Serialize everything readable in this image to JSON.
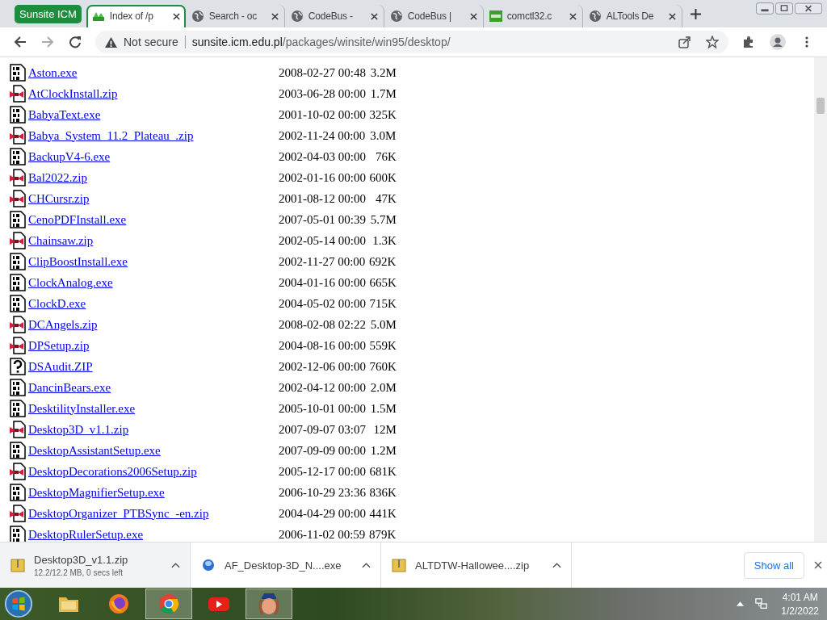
{
  "browser": {
    "tab_group": "Sunsite ICM",
    "tabs": [
      {
        "title": "Index of /p",
        "kind": "sunsite",
        "selected": true
      },
      {
        "title": "Search - oc",
        "kind": "globe",
        "selected": false
      },
      {
        "title": "CodeBus -",
        "kind": "globe",
        "selected": false
      },
      {
        "title": "CodeBus |",
        "kind": "globe",
        "selected": false
      },
      {
        "title": "comctl32.c",
        "kind": "ocx",
        "selected": false
      },
      {
        "title": "ALTools De",
        "kind": "globe",
        "selected": false
      }
    ],
    "security": "Not secure",
    "url_host": "sunsite.icm.edu.pl",
    "url_path": "/packages/winsite/win95/desktop/"
  },
  "listing": [
    {
      "name": "Aston.exe",
      "kind": "exe",
      "date": "2008-02-27 00:48",
      "size": "3.2M"
    },
    {
      "name": "AtClockInstall.zip",
      "kind": "zip",
      "date": "2003-06-28 00:00",
      "size": "1.7M"
    },
    {
      "name": "BabyaText.exe",
      "kind": "exe",
      "date": "2001-10-02 00:00",
      "size": "325K"
    },
    {
      "name": "Babya_System_11.2_Plateau_.zip",
      "kind": "zip",
      "date": "2002-11-24 00:00",
      "size": "3.0M"
    },
    {
      "name": "BackupV4-6.exe",
      "kind": "exe",
      "date": "2002-04-03 00:00",
      "size": "76K"
    },
    {
      "name": "Bal2022.zip",
      "kind": "zip",
      "date": "2002-01-16 00:00",
      "size": "600K"
    },
    {
      "name": "CHCursr.zip",
      "kind": "zip",
      "date": "2001-08-12 00:00",
      "size": "47K"
    },
    {
      "name": "CenoPDFInstall.exe",
      "kind": "exe",
      "date": "2007-05-01 00:39",
      "size": "5.7M"
    },
    {
      "name": "Chainsaw.zip",
      "kind": "zip",
      "date": "2002-05-14 00:00",
      "size": "1.3K"
    },
    {
      "name": "ClipBoostInstall.exe",
      "kind": "exe",
      "date": "2002-11-27 00:00",
      "size": "692K"
    },
    {
      "name": "ClockAnalog.exe",
      "kind": "exe",
      "date": "2004-01-16 00:00",
      "size": "665K"
    },
    {
      "name": "ClockD.exe",
      "kind": "exe",
      "date": "2004-05-02 00:00",
      "size": "715K"
    },
    {
      "name": "DCAngels.zip",
      "kind": "zip",
      "date": "2008-02-08 02:22",
      "size": "5.0M"
    },
    {
      "name": "DPSetup.zip",
      "kind": "zip",
      "date": "2004-08-16 00:00",
      "size": "559K"
    },
    {
      "name": "DSAudit.ZIP",
      "kind": "unknown",
      "date": "2002-12-06 00:00",
      "size": "760K"
    },
    {
      "name": "DancinBears.exe",
      "kind": "exe",
      "date": "2002-04-12 00:00",
      "size": "2.0M"
    },
    {
      "name": "DesktilityInstaller.exe",
      "kind": "exe",
      "date": "2005-10-01 00:00",
      "size": "1.5M"
    },
    {
      "name": "Desktop3D_v1.1.zip",
      "kind": "zip",
      "date": "2007-09-07 03:07",
      "size": "12M"
    },
    {
      "name": "DesktopAssistantSetup.exe",
      "kind": "exe",
      "date": "2007-09-09 00:00",
      "size": "1.2M"
    },
    {
      "name": "DesktopDecorations2006Setup.zip",
      "kind": "zip",
      "date": "2005-12-17 00:00",
      "size": "681K"
    },
    {
      "name": "DesktopMagnifierSetup.exe",
      "kind": "exe",
      "date": "2006-10-29 23:36",
      "size": "836K"
    },
    {
      "name": "DesktopOrganizer_PTBSync_-en.zip",
      "kind": "zip",
      "date": "2004-04-29 00:00",
      "size": "441K"
    },
    {
      "name": "DesktopRulerSetup.exe",
      "kind": "exe",
      "date": "2006-11-02 00:59",
      "size": "879K"
    }
  ],
  "downloads": {
    "items": [
      {
        "name": "Desktop3D_v1.1.zip",
        "status": "12.2/12.2 MB, 0 secs left",
        "kind": "zip",
        "selected": true
      },
      {
        "name": "AF_Desktop-3D_N....exe",
        "kind": "exe",
        "selected": false
      },
      {
        "name": "ALTDTW-Hallowee....zip",
        "kind": "zip",
        "selected": false
      }
    ],
    "show_all": "Show all"
  },
  "taskbar": {
    "apps": [
      {
        "kind": "explorer",
        "selected": false
      },
      {
        "kind": "firefox",
        "selected": false
      },
      {
        "kind": "chrome",
        "selected": true
      },
      {
        "kind": "youtube",
        "selected": false
      },
      {
        "kind": "character",
        "selected": true
      }
    ],
    "time": "4:01 AM",
    "date": "1/2/2022"
  }
}
